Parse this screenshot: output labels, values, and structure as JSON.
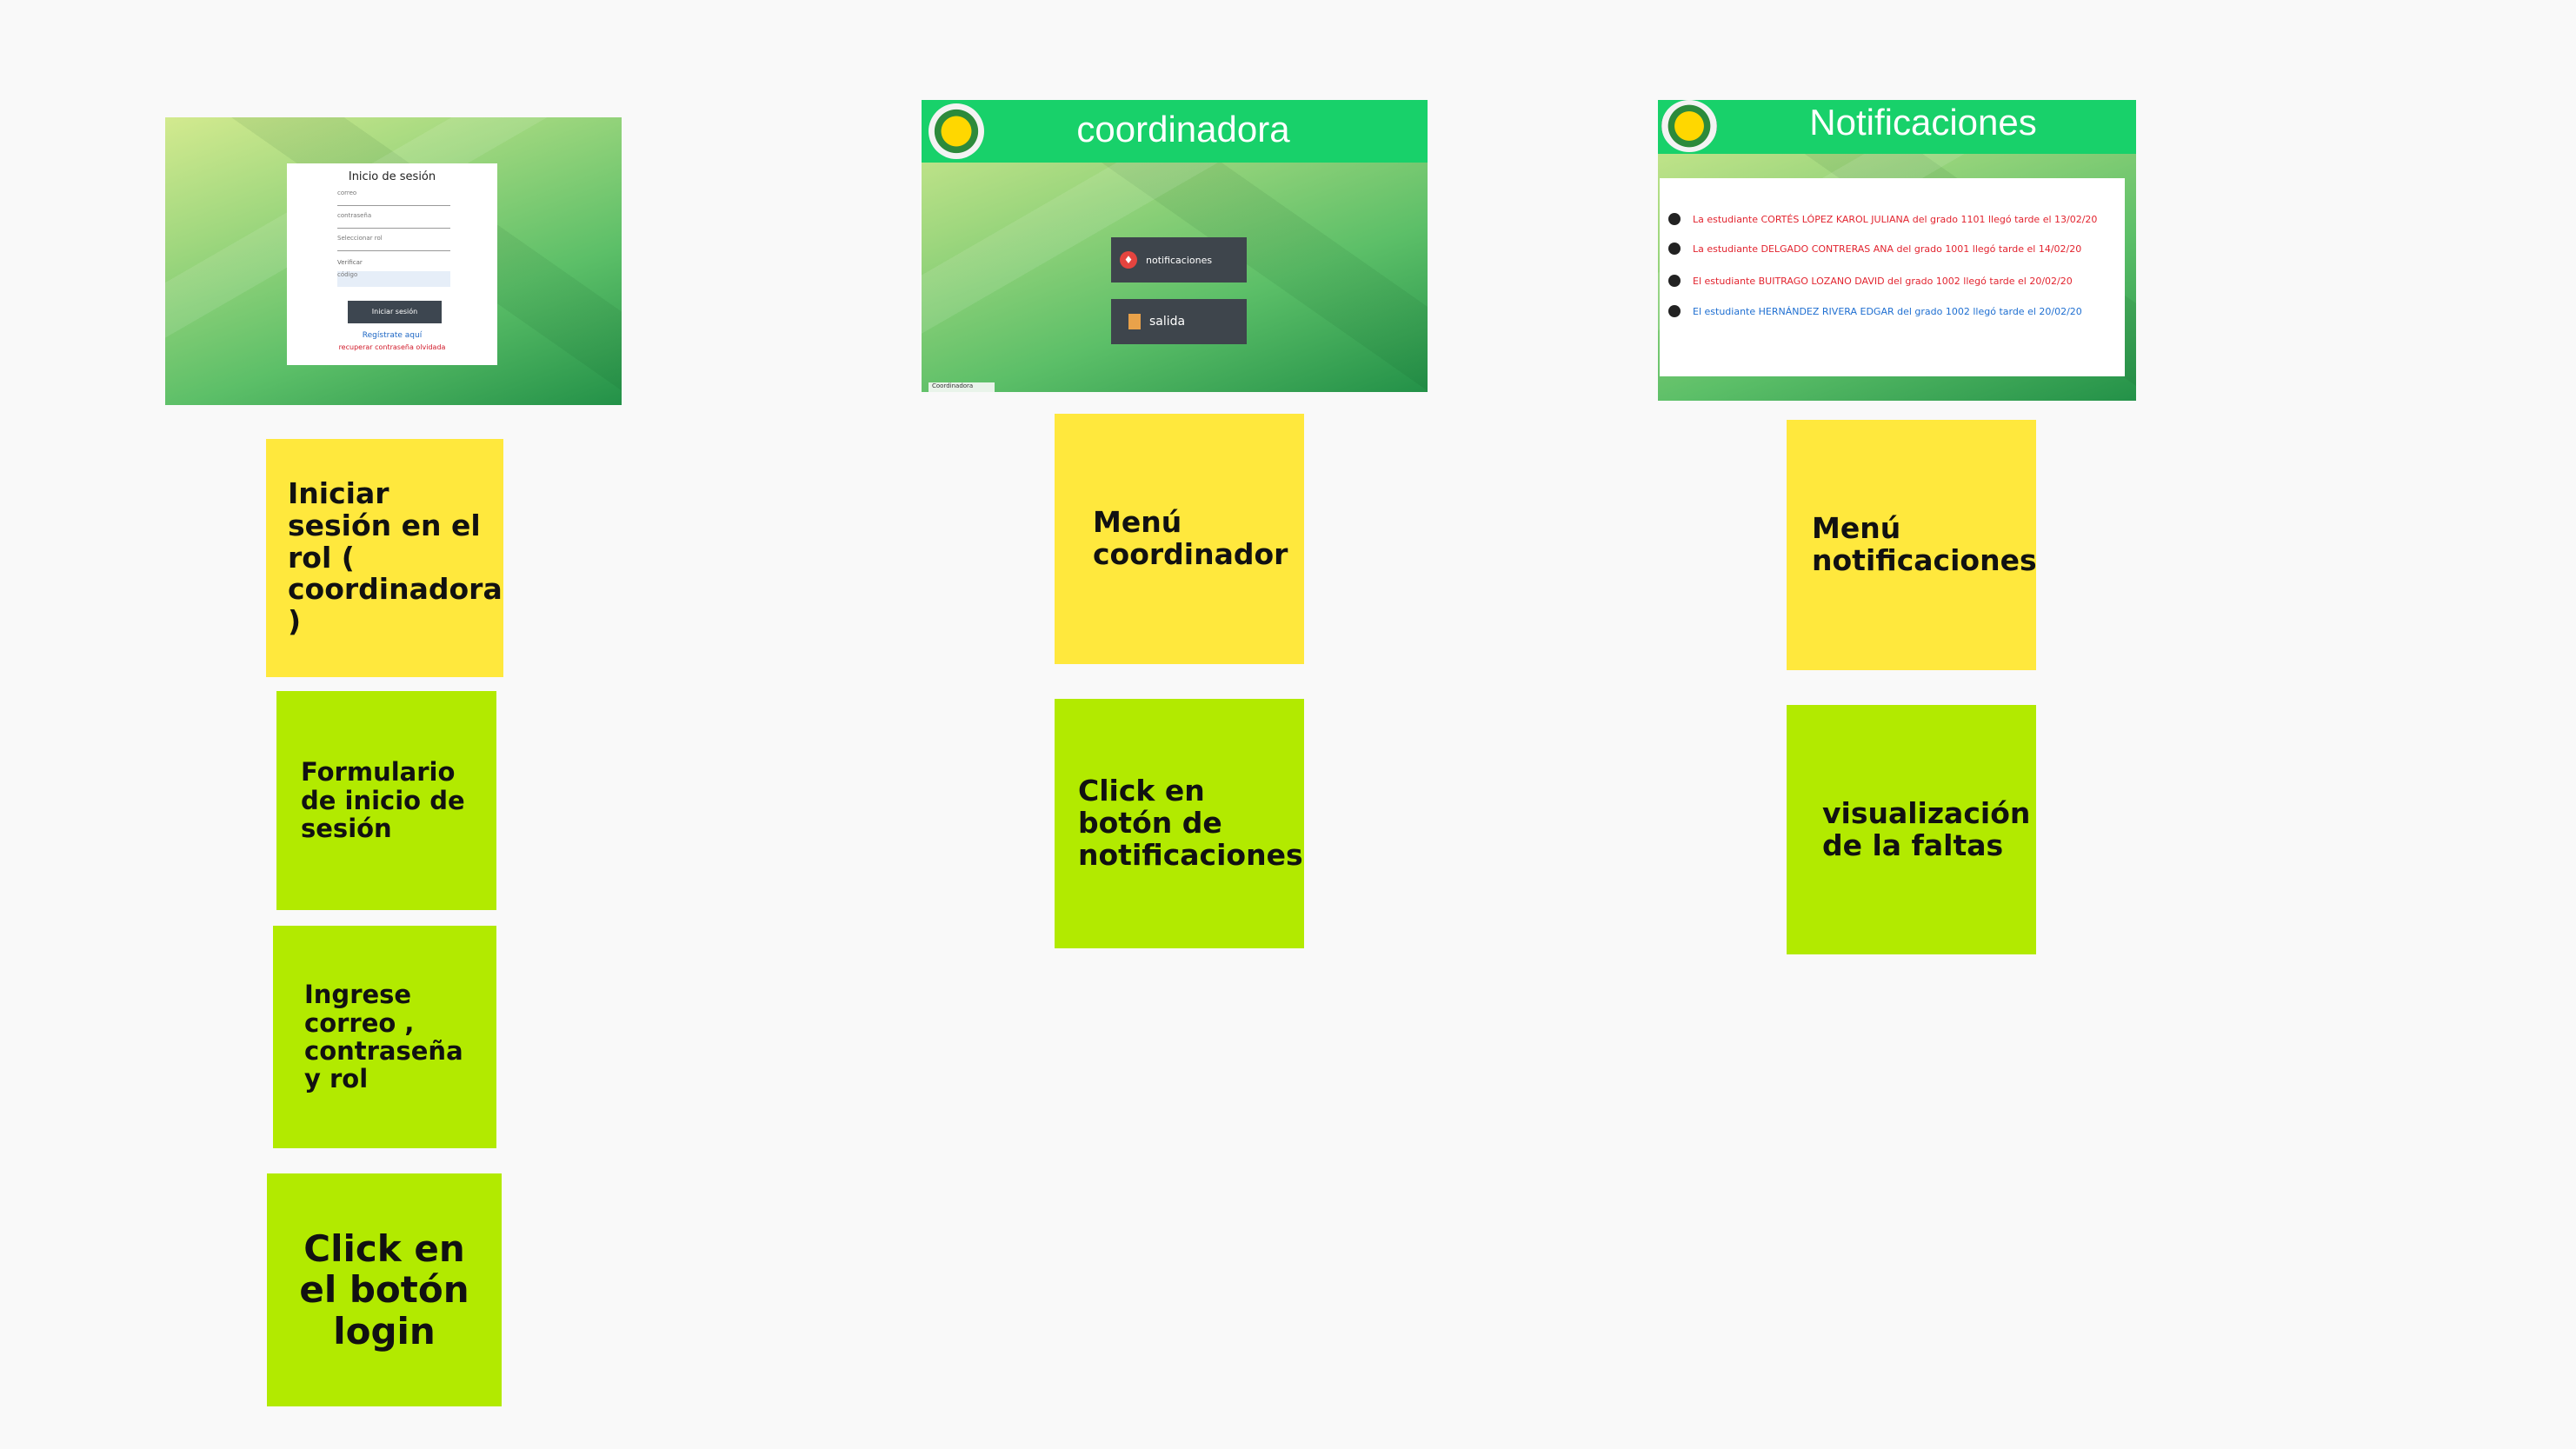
{
  "login_screenshot": {
    "title": "Inicio de sesión",
    "email_placeholder": "correo",
    "password_placeholder": "contraseña",
    "role_select": "Seleccionar rol",
    "small_label": "Verificar",
    "small_field": "código",
    "button": "Iniciar sesión",
    "register_link": "Regístrate aquí",
    "recover_link": "recuperar contraseña olvidada"
  },
  "coordinator_screenshot": {
    "title": "coordinadora",
    "buttons": [
      "notificaciones",
      "salida"
    ],
    "footer_tag": "Coordinadora"
  },
  "notifications_screenshot": {
    "title": "Notificaciones",
    "items": [
      {
        "text": "La estudiante CORTÉS LÓPEZ KAROL JULIANA del grado 1101 llegó tarde el 13/02/20",
        "color": "#e2242f"
      },
      {
        "text": "La estudiante DELGADO CONTRERAS ANA del grado 1001 llegó tarde el 14/02/20",
        "color": "#e2242f"
      },
      {
        "text": "El estudiante BUITRAGO LOZANO DAVID del grado 1002 llegó tarde el 20/02/20",
        "color": "#e2242f"
      },
      {
        "text": "El estudiante HERNÁNDEZ RIVERA EDGAR del grado 1002 llegó tarde el 20/02/20",
        "color": "#1f6fd1"
      }
    ]
  },
  "notes": {
    "col1": {
      "yellow": "Iniciar sesión en el rol ( coordinadora )",
      "lime1": "Formulario de inicio de sesión",
      "lime2": "Ingrese correo , contraseña y rol",
      "lime3": "Click en el botón login"
    },
    "col2": {
      "yellow": "Menú coordinador",
      "lime": "Click en botón de notificaciones"
    },
    "col3": {
      "yellow": "Menú notificaciones",
      "lime": "visualización de la faltas"
    }
  },
  "colors": {
    "yellow_note": "#ffe83d",
    "lime_note": "#b2ea00",
    "banner_green": "#18d16a",
    "background": "#f9f9f9"
  }
}
